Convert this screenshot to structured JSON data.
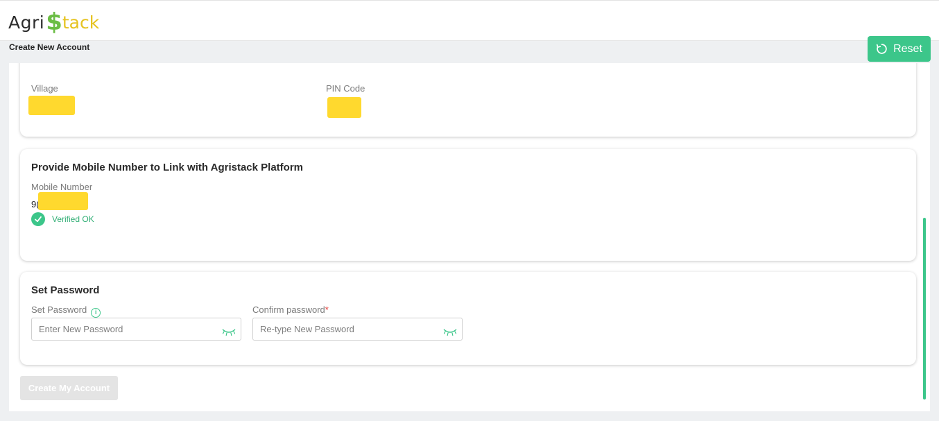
{
  "header": {
    "logo": {
      "agri": "Agri",
      "dollar": "$",
      "tack": "tack"
    }
  },
  "page": {
    "title": "Create New Account",
    "reset_label": "Reset"
  },
  "address": {
    "village_label": "Village",
    "pin_label": "PIN Code"
  },
  "mobile": {
    "title": "Provide Mobile Number to Link with Agristack Platform",
    "label": "Mobile Number",
    "value_prefix": "9(",
    "verified_text": "Verified OK"
  },
  "password": {
    "title": "Set Password",
    "set_label": "Set Password",
    "confirm_label": "Confirm password",
    "required_mark": "*",
    "set_placeholder": "Enter New Password",
    "confirm_placeholder": "Re-type New Password"
  },
  "actions": {
    "create_label": "Create My Account"
  },
  "colors": {
    "accent": "#3cc68a",
    "redaction": "#ffd92e",
    "disabled_button": "#e4e4e4"
  },
  "icons": [
    "reset-icon",
    "check-icon",
    "info-icon",
    "eye-closed-icon"
  ]
}
